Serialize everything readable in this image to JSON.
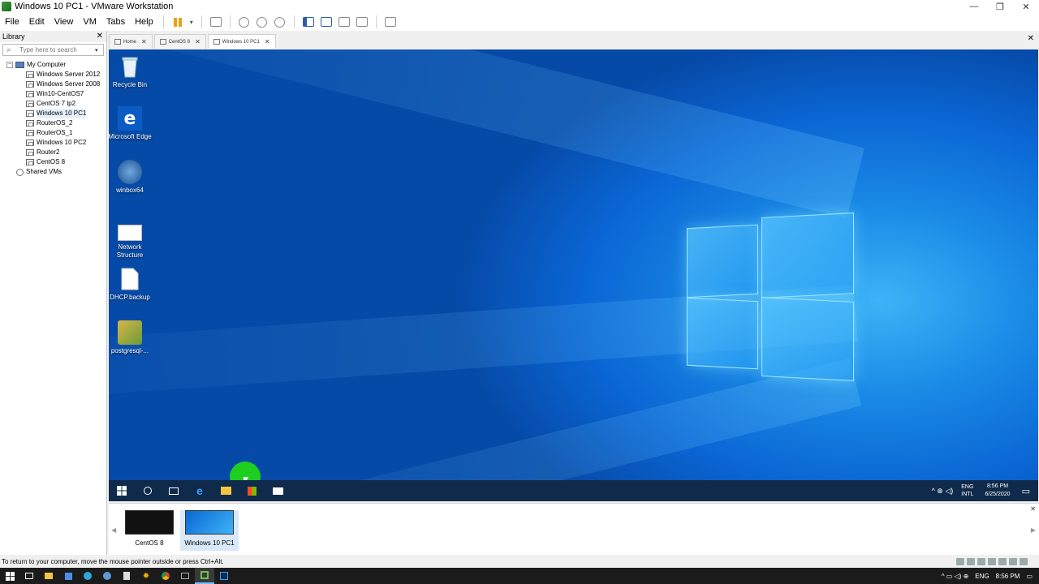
{
  "window": {
    "title": "Windows 10 PC1 - VMware Workstation",
    "controls": [
      "minimize",
      "restore",
      "close"
    ]
  },
  "menu": {
    "items": [
      "File",
      "Edit",
      "View",
      "VM",
      "Tabs",
      "Help"
    ]
  },
  "library": {
    "title": "Library",
    "search_placeholder": "Type here to search",
    "root": "My Computer",
    "vms": [
      "Windows Server 2012",
      "Windows Server 2008",
      "Win10-CentOS7",
      "CentOS 7 lp2",
      "Windows 10 PC1",
      "RouterOS_2",
      "RouterOS_1",
      "Windows 10 PC2",
      "Router2",
      "CentOS 8"
    ],
    "shared": "Shared VMs",
    "selected": "Windows 10 PC1"
  },
  "tabs": [
    {
      "label": "Home"
    },
    {
      "label": "CentOS 8"
    },
    {
      "label": "Windows 10 PC1",
      "active": true
    }
  ],
  "desktop": {
    "icons": [
      {
        "label": "Recycle Bin",
        "icon": "recycle-bin-icon"
      },
      {
        "label": "Microsoft Edge",
        "icon": "edge-icon"
      },
      {
        "label": "winbox64",
        "icon": "winbox-icon"
      },
      {
        "label": "Network Structure",
        "icon": "network-image-icon"
      },
      {
        "label": "DHCP.backup",
        "icon": "file-icon"
      },
      {
        "label": "postgresql-...",
        "icon": "installer-icon"
      }
    ],
    "taskbar": {
      "language": "ENG",
      "layout": "INTL",
      "time": "8:56 PM",
      "date": "6/25/2020"
    }
  },
  "thumbnails": [
    {
      "label": "CentOS 8"
    },
    {
      "label": "Windows 10 PC1",
      "active": true
    }
  ],
  "status": {
    "message": "To return to your computer, move the mouse pointer outside or press Ctrl+Alt."
  },
  "host_taskbar": {
    "language": "ENG",
    "time": "8:56 PM"
  },
  "colors": {
    "desktop_blue": "#0a66d4",
    "accent": "#3db4f7",
    "pause": "#e6a117"
  }
}
